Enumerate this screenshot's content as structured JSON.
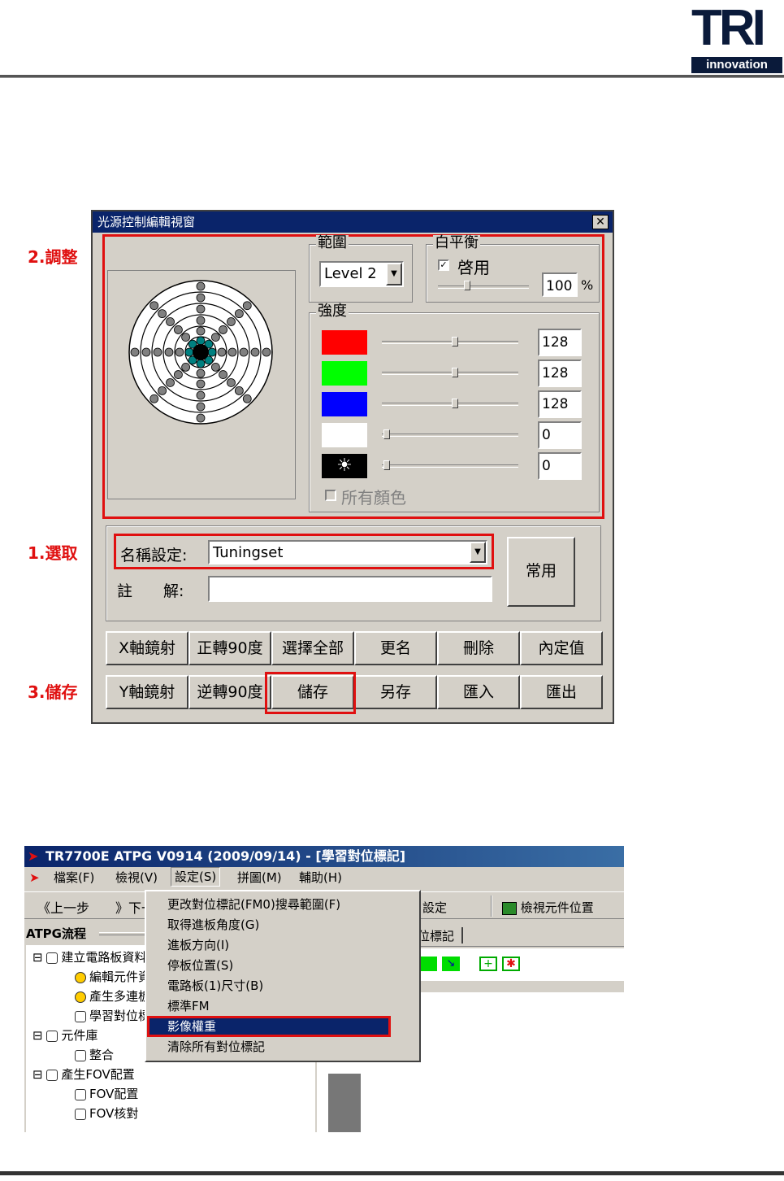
{
  "header": {
    "logo_mark": "TRI",
    "logo_sub": "innovation"
  },
  "steps": {
    "adjust": "2.調整",
    "select": "1.選取",
    "save": "3.儲存"
  },
  "dialog": {
    "title": "光源控制編輯視窗",
    "close_glyph": "✕",
    "range": {
      "label": "範圍",
      "selected": "Level 2"
    },
    "white_balance": {
      "label": "白平衡",
      "enable_label": "啓用",
      "enable_checked": true,
      "value": "100",
      "unit": "%"
    },
    "intensity": {
      "label": "強度",
      "channels": [
        {
          "name": "red",
          "color": "#ff0000",
          "value": "128",
          "level": 0.5
        },
        {
          "name": "green",
          "color": "#00ff00",
          "value": "128",
          "level": 0.5
        },
        {
          "name": "blue",
          "color": "#0000ff",
          "value": "128",
          "level": 0.5
        },
        {
          "name": "white",
          "color": "#ffffff",
          "value": "0",
          "level": 0.0
        },
        {
          "name": "light",
          "color": "#000000",
          "value": "0",
          "level": 0.0
        }
      ],
      "all_colors_label": "所有顏色"
    },
    "name_setting": {
      "label": "名稱設定:",
      "value": "Tuningset"
    },
    "note": {
      "label": "註　　解:",
      "value": ""
    },
    "common_button": "常用",
    "buttons_row1": [
      "X軸鏡射",
      "正轉90度",
      "選擇全部",
      "更名",
      "刪除",
      "內定值"
    ],
    "buttons_row2": [
      "Y軸鏡射",
      "逆轉90度",
      "儲存",
      "另存",
      "匯入",
      "匯出"
    ]
  },
  "app": {
    "title": "TR7700E ATPG V0914 (2009/09/14) - [學習對位標記]",
    "menus": [
      "檔案(F)",
      "檢視(V)",
      "設定(S)",
      "拼圖(M)",
      "輔助(H)"
    ],
    "toolbar": {
      "prev": "上一步",
      "next": "下一",
      "settings": "設定",
      "view_component": "檢視元件位置"
    },
    "panel_title": "ATPG流程",
    "tab_label": "位標記",
    "tree": [
      {
        "label": "建立電路板資料",
        "level": 0
      },
      {
        "label": "編輯元件資",
        "level": 1
      },
      {
        "label": "產生多連板",
        "level": 1
      },
      {
        "label": "學習對位標",
        "level": 1
      },
      {
        "label": "元件庫",
        "level": 0
      },
      {
        "label": "整合",
        "level": 1
      },
      {
        "label": "產生FOV配置",
        "level": 0
      },
      {
        "label": "FOV配置",
        "level": 1
      },
      {
        "label": "FOV核對",
        "level": 1
      }
    ],
    "settings_menu": [
      "更改對位標記(FM0)搜尋範圍(F)",
      "取得進板角度(G)",
      "進板方向(I)",
      "停板位置(S)",
      "電路板(1)尺寸(B)",
      "標準FM",
      "影像權重",
      "清除所有對位標記"
    ],
    "highlighted_item": "影像權重"
  },
  "colors": {
    "highlight_red": "#e01010",
    "titlebar_blue": "#0a246a",
    "dialog_gray": "#d4d0c8"
  }
}
